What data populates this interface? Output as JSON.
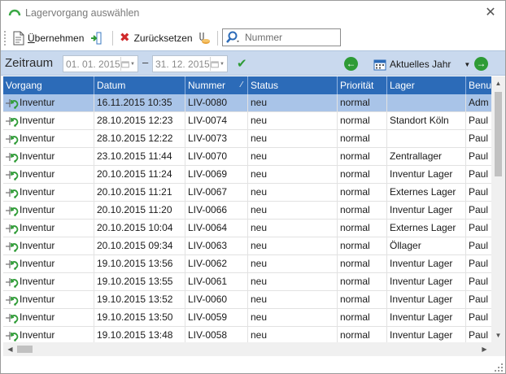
{
  "window": {
    "title": "Lagervorgang auswählen",
    "close_glyph": "✕"
  },
  "toolbar": {
    "apply_label": "Übernehmen",
    "apply_mnemonic": "Ü",
    "apply_rest": "bernehmen",
    "reset_label": "Zurücksetzen",
    "search_placeholder": "Nummer",
    "search_value": ""
  },
  "period": {
    "label": "Zeitraum",
    "from": "01. 01. 2015",
    "to": "31. 12. 2015",
    "dash": "–",
    "preset": "Aktuelles Jahr"
  },
  "grid": {
    "columns": [
      "Vorgang",
      "Datum",
      "Nummer",
      "Status",
      "Priorität",
      "Lager",
      "Benu"
    ],
    "sorted_column": "Nummer",
    "rows": [
      {
        "vorgang": "Inventur",
        "datum": "16.11.2015 10:35",
        "nummer": "LIV-0080",
        "status": "neu",
        "prioritaet": "normal",
        "lager": "",
        "benutzer": "Adm",
        "selected": true
      },
      {
        "vorgang": "Inventur",
        "datum": "28.10.2015 12:23",
        "nummer": "LIV-0074",
        "status": "neu",
        "prioritaet": "normal",
        "lager": "Standort Köln",
        "benutzer": "Paul"
      },
      {
        "vorgang": "Inventur",
        "datum": "28.10.2015 12:22",
        "nummer": "LIV-0073",
        "status": "neu",
        "prioritaet": "normal",
        "lager": "",
        "benutzer": "Paul"
      },
      {
        "vorgang": "Inventur",
        "datum": "23.10.2015 11:44",
        "nummer": "LIV-0070",
        "status": "neu",
        "prioritaet": "normal",
        "lager": "Zentrallager",
        "benutzer": "Paul"
      },
      {
        "vorgang": "Inventur",
        "datum": "20.10.2015 11:24",
        "nummer": "LIV-0069",
        "status": "neu",
        "prioritaet": "normal",
        "lager": "Inventur Lager",
        "benutzer": "Paul"
      },
      {
        "vorgang": "Inventur",
        "datum": "20.10.2015 11:21",
        "nummer": "LIV-0067",
        "status": "neu",
        "prioritaet": "normal",
        "lager": "Externes Lager",
        "benutzer": "Paul"
      },
      {
        "vorgang": "Inventur",
        "datum": "20.10.2015 11:20",
        "nummer": "LIV-0066",
        "status": "neu",
        "prioritaet": "normal",
        "lager": "Inventur Lager",
        "benutzer": "Paul"
      },
      {
        "vorgang": "Inventur",
        "datum": "20.10.2015 10:04",
        "nummer": "LIV-0064",
        "status": "neu",
        "prioritaet": "normal",
        "lager": "Externes Lager",
        "benutzer": "Paul"
      },
      {
        "vorgang": "Inventur",
        "datum": "20.10.2015 09:34",
        "nummer": "LIV-0063",
        "status": "neu",
        "prioritaet": "normal",
        "lager": "Öllager",
        "benutzer": "Paul"
      },
      {
        "vorgang": "Inventur",
        "datum": "19.10.2015 13:56",
        "nummer": "LIV-0062",
        "status": "neu",
        "prioritaet": "normal",
        "lager": "Inventur Lager",
        "benutzer": "Paul"
      },
      {
        "vorgang": "Inventur",
        "datum": "19.10.2015 13:55",
        "nummer": "LIV-0061",
        "status": "neu",
        "prioritaet": "normal",
        "lager": "Inventur Lager",
        "benutzer": "Paul"
      },
      {
        "vorgang": "Inventur",
        "datum": "19.10.2015 13:52",
        "nummer": "LIV-0060",
        "status": "neu",
        "prioritaet": "normal",
        "lager": "Inventur Lager",
        "benutzer": "Paul"
      },
      {
        "vorgang": "Inventur",
        "datum": "19.10.2015 13:50",
        "nummer": "LIV-0059",
        "status": "neu",
        "prioritaet": "normal",
        "lager": "Inventur Lager",
        "benutzer": "Paul"
      },
      {
        "vorgang": "Inventur",
        "datum": "19.10.2015 13:48",
        "nummer": "LIV-0058",
        "status": "neu",
        "prioritaet": "normal",
        "lager": "Inventur Lager",
        "benutzer": "Paul"
      }
    ]
  },
  "icons": {
    "app": "arc-app-icon",
    "apply": "document-apply-icon",
    "apply_split": "split-columns-icon",
    "reset": "red-x-reset-icon",
    "reset_extra": "clear-filter-icon",
    "search": "magnifier-icon",
    "calendar": "calendar-icon",
    "confirm": "green-check-icon",
    "prev": "arrow-left-icon",
    "next": "arrow-right-icon",
    "row": "inventory-icon"
  },
  "colors": {
    "header_bg": "#2c6bb8",
    "period_bg": "#c9d9ee",
    "selected_row": "#a9c4e8",
    "accent_green": "#2e9b36",
    "reset_red": "#d0292b"
  }
}
